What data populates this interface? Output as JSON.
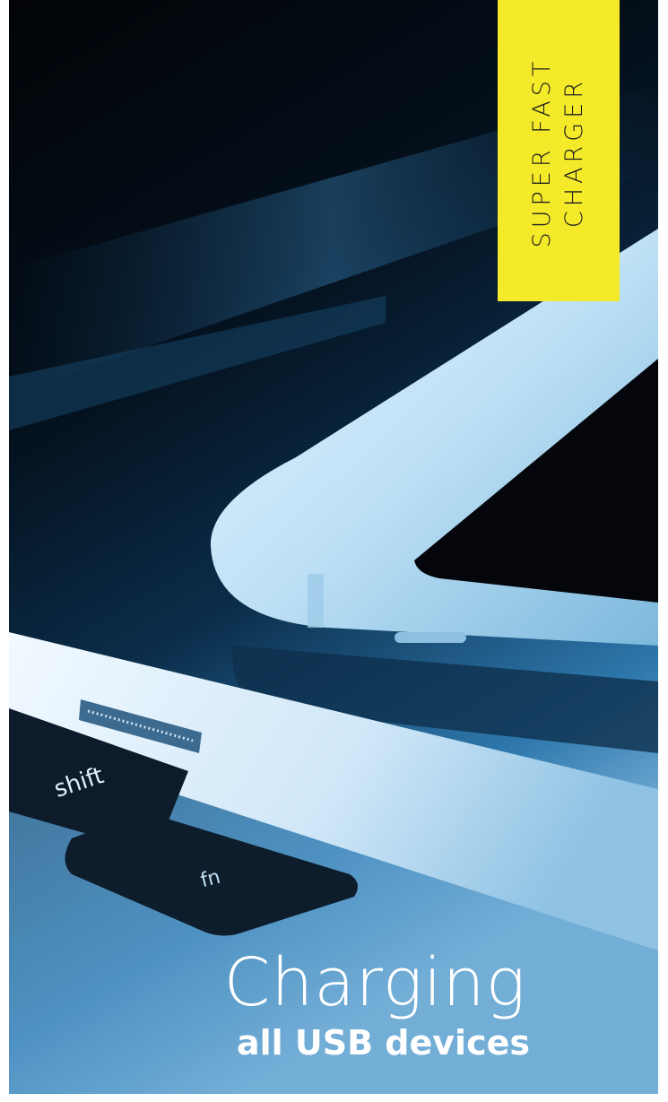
{
  "badge": {
    "line1": "SUPER FAST",
    "line2": "CHARGER",
    "color": "#f4ea2a"
  },
  "caption": {
    "title": "Charging",
    "subtitle": "all USB devices"
  },
  "photo": {
    "keys": {
      "shift": "shift",
      "fn": "fn"
    }
  }
}
